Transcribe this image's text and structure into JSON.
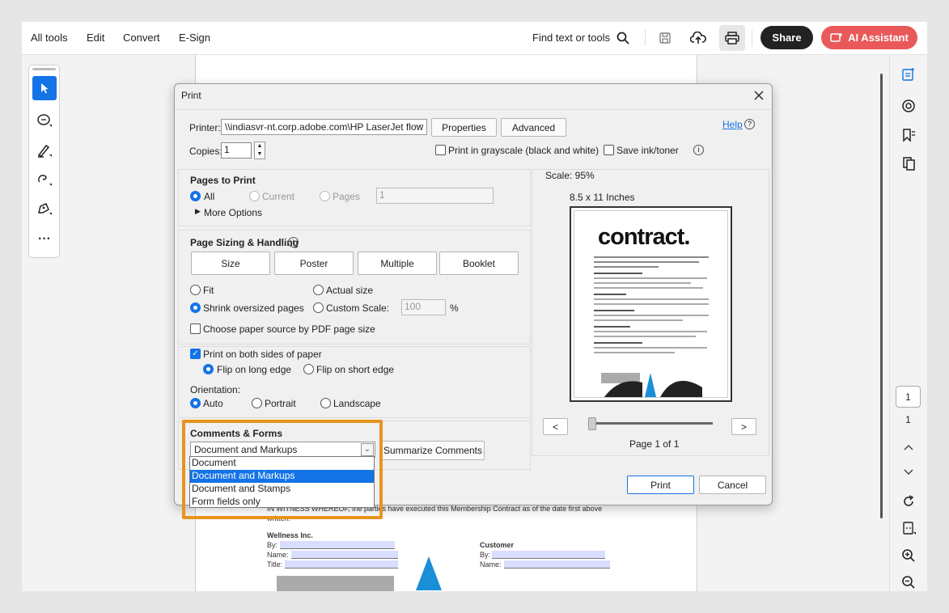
{
  "topbar": {
    "menu": [
      "All tools",
      "Edit",
      "Convert",
      "E-Sign"
    ],
    "find_label": "Find text or tools",
    "share_label": "Share",
    "ai_label": "AI Assistant"
  },
  "document": {
    "witness_text": "IN WITNESS WHEREOF, the parties have executed this Membership Contract as of the date first above",
    "witness_text2": "written.",
    "company": "Wellness Inc.",
    "customer": "Customer",
    "by": "By:",
    "name": "Name:",
    "title": "Title:"
  },
  "rightrail": {
    "page_box": "1",
    "page_num": "1"
  },
  "dialog": {
    "title": "Print",
    "printer_label": "Printer:",
    "printer_value": "\\\\indiasvr-nt.corp.adobe.com\\HP LaserJet flow M",
    "properties": "Properties",
    "advanced": "Advanced",
    "help": "Help",
    "copies_label": "Copies:",
    "copies_value": "1",
    "grayscale": "Print in grayscale (black and white)",
    "save_ink": "Save ink/toner",
    "pages_to_print": {
      "heading": "Pages to Print",
      "all": "All",
      "current": "Current",
      "pages": "Pages",
      "pages_value": "1",
      "more_options": "More Options"
    },
    "sizing": {
      "heading": "Page Sizing & Handling",
      "tabs": [
        "Size",
        "Poster",
        "Multiple",
        "Booklet"
      ],
      "fit": "Fit",
      "actual_size": "Actual size",
      "shrink": "Shrink oversized pages",
      "custom_scale": "Custom Scale:",
      "custom_scale_value": "100",
      "percent": "%",
      "paper_source": "Choose paper source by PDF page size",
      "both_sides": "Print on both sides of paper",
      "flip_long": "Flip on long edge",
      "flip_short": "Flip on short edge",
      "orientation": "Orientation:",
      "auto": "Auto",
      "portrait": "Portrait",
      "landscape": "Landscape"
    },
    "comments": {
      "heading": "Comments & Forms",
      "selected": "Document and Markups",
      "summarize": "Summarize Comments",
      "options": [
        "Document",
        "Document and Markups",
        "Document and Stamps",
        "Form fields only"
      ],
      "selected_index": 1
    },
    "preview": {
      "scale": "Scale:  95%",
      "paper": "8.5 x 11 Inches",
      "doc_title": "contract.",
      "prev": "<",
      "next": ">",
      "page_of": "Page 1 of 1"
    },
    "print": "Print",
    "cancel": "Cancel"
  },
  "colors": {
    "accent": "#1473e6",
    "ai_button": "#e9595a",
    "highlight": "#e8941f"
  }
}
